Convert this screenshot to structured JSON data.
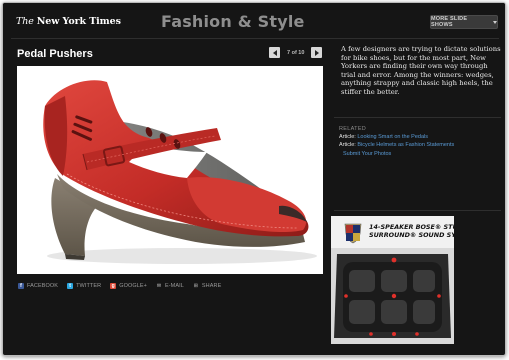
{
  "header": {
    "logo_prefix": "The ",
    "logo_main": "New York Times",
    "section_title": "Fashion & Style",
    "more_button": "MORE SLIDE SHOWS"
  },
  "slide": {
    "title": "Pedal Pushers",
    "counter": "7 of 10",
    "image_subject": "red mary-jane heel shoe"
  },
  "share": [
    {
      "label": "FACEBOOK",
      "icon": "facebook-icon",
      "color": "#3b5998",
      "glyph": "f"
    },
    {
      "label": "TWITTER",
      "icon": "twitter-icon",
      "color": "#2aa7e0",
      "glyph": "t"
    },
    {
      "label": "GOOGLE+",
      "icon": "google-plus-icon",
      "color": "#dd4b39",
      "glyph": "g"
    },
    {
      "label": "E-MAIL",
      "icon": "email-icon",
      "color": "#6d6d6d",
      "glyph": "✉"
    },
    {
      "label": "SHARE",
      "icon": "share-icon",
      "color": "#6d6d6d",
      "glyph": "⊞"
    }
  ],
  "caption": "A few designers are trying to dictate solutions for bike shoes, but for the most part, New Yorkers are finding their own way through trial and error. Among the winners: wedges, anything strappy and classic high heels, the stiffer the better.",
  "related": {
    "heading": "RELATED",
    "items": [
      {
        "kind": "Article:",
        "link": "Looking Smart on the Pedals"
      },
      {
        "kind": "Article:",
        "link": "Bicycle Helmets as Fashion Statements"
      }
    ],
    "submit": "Submit Your Photos"
  },
  "ad": {
    "line1": "14-SPEAKER BOSE® STUDIO",
    "line2": "SURROUND® SOUND SYSTEM",
    "brand_icon": "cadillac-crest-icon"
  },
  "colors": {
    "background": "#151515",
    "link": "#5a9bd6",
    "section_title": "#8e8e8e",
    "shoe": "#c8312c"
  }
}
